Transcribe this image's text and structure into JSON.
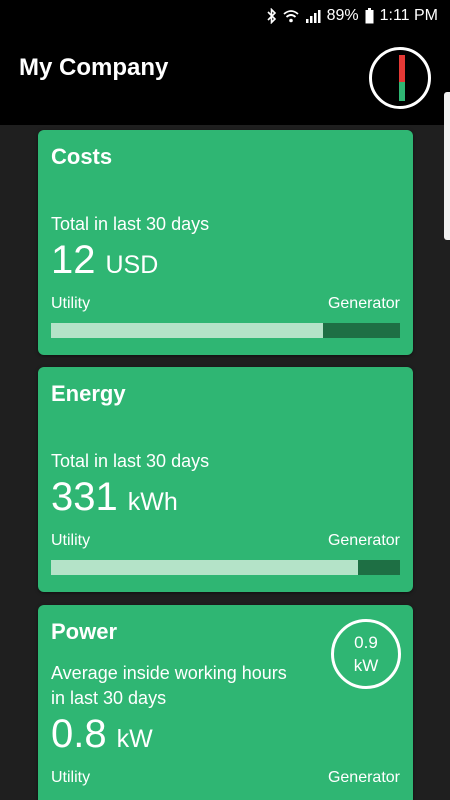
{
  "status_bar": {
    "battery": "89%",
    "time": "1:11 PM",
    "icons": [
      "bluetooth-icon",
      "wifi-icon",
      "signal-icon",
      "battery-icon"
    ]
  },
  "app_bar": {
    "title": "My Company",
    "meter_icon": "power-meter-icon"
  },
  "cards": {
    "costs": {
      "title": "Costs",
      "subtitle": "Total in last 30 days",
      "value": "12",
      "unit": "USD",
      "utility_label": "Utility",
      "generator_label": "Generator",
      "utility_share": 0.78
    },
    "energy": {
      "title": "Energy",
      "subtitle": "Total in last 30 days",
      "value": "331",
      "unit": "kWh",
      "utility_label": "Utility",
      "generator_label": "Generator",
      "utility_share": 0.88
    },
    "power": {
      "title": "Power",
      "subtitle_line1": "Average inside working hours",
      "subtitle_line2": "in last 30 days",
      "value": "0.8",
      "unit": "kW",
      "badge_value": "0.9",
      "badge_unit": "kW",
      "utility_label": "Utility",
      "generator_label": "Generator"
    }
  },
  "colors": {
    "card_green": "#2fb673",
    "bar_utility": "#b4e3c8",
    "bar_generator": "#1e6f44",
    "meter_red": "#e53935"
  }
}
